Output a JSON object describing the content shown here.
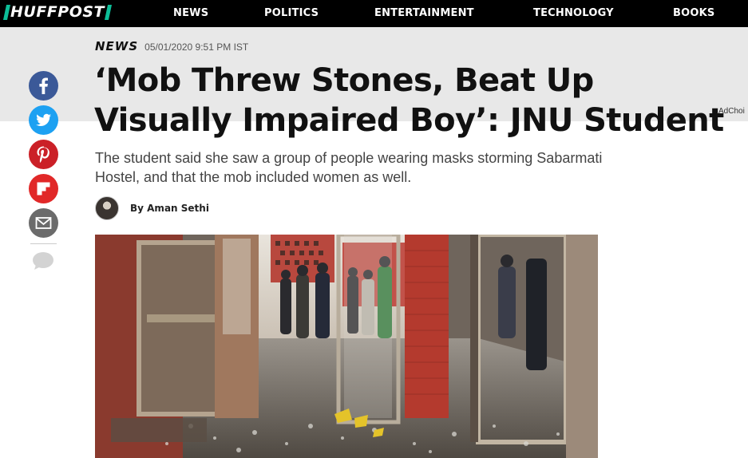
{
  "site": {
    "logo_text": "HUFFPOST",
    "nav": [
      "NEWS",
      "POLITICS",
      "ENTERTAINMENT",
      "TECHNOLOGY",
      "BOOKS"
    ]
  },
  "ad": {
    "adchoices_label": "AdChoi"
  },
  "article": {
    "section": "NEWS",
    "timestamp": "05/01/2020 9:51 PM IST",
    "headline": "‘Mob Threw Stones, Beat Up Visually Impaired Boy’: JNU Student",
    "dek": "The student said she saw a group of people wearing masks storming Sabarmati Hostel, and that the mob included women as well.",
    "byline": "By Aman Sethi"
  },
  "share": [
    {
      "name": "facebook",
      "icon": "facebook-icon",
      "color": "#3b5998"
    },
    {
      "name": "twitter",
      "icon": "twitter-icon",
      "color": "#1da1f2"
    },
    {
      "name": "pinterest",
      "icon": "pinterest-icon",
      "color": "#cb2027"
    },
    {
      "name": "flipboard",
      "icon": "flipboard-icon",
      "color": "#e12828"
    },
    {
      "name": "email",
      "icon": "email-icon",
      "color": "#6b6b6b"
    },
    {
      "name": "comments",
      "icon": "comment-icon",
      "color": "#d3d3d3"
    }
  ],
  "colors": {
    "brand_accent": "#0dbe98",
    "nav_background": "#000000",
    "ad_band": "#e8e8e8"
  }
}
